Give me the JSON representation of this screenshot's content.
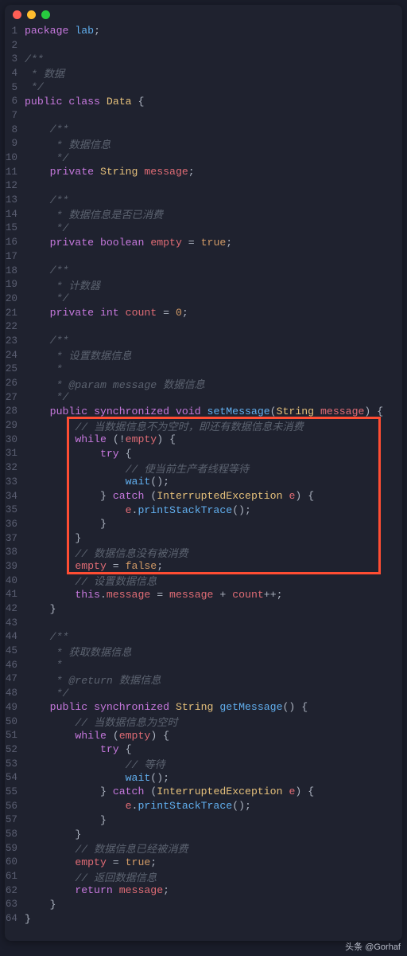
{
  "window": {
    "dots": [
      "red",
      "yellow",
      "green"
    ]
  },
  "code": {
    "lines": [
      [
        [
          "kw",
          "package"
        ],
        [
          "pl",
          " "
        ],
        [
          "id",
          "lab"
        ],
        [
          "pu",
          ";"
        ]
      ],
      [],
      [
        [
          "cm",
          "/**"
        ]
      ],
      [
        [
          "cm",
          " * 数据"
        ]
      ],
      [
        [
          "cm",
          " */"
        ]
      ],
      [
        [
          "kw",
          "public"
        ],
        [
          "pl",
          " "
        ],
        [
          "kw",
          "class"
        ],
        [
          "pl",
          " "
        ],
        [
          "ty",
          "Data"
        ],
        [
          "pl",
          " "
        ],
        [
          "pu",
          "{"
        ]
      ],
      [],
      [
        [
          "pl",
          "    "
        ],
        [
          "cm",
          "/**"
        ]
      ],
      [
        [
          "pl",
          "    "
        ],
        [
          "cm",
          " * 数据信息"
        ]
      ],
      [
        [
          "pl",
          "    "
        ],
        [
          "cm",
          " */"
        ]
      ],
      [
        [
          "pl",
          "    "
        ],
        [
          "kw",
          "private"
        ],
        [
          "pl",
          " "
        ],
        [
          "ty",
          "String"
        ],
        [
          "pl",
          " "
        ],
        [
          "va",
          "message"
        ],
        [
          "pu",
          ";"
        ]
      ],
      [],
      [
        [
          "pl",
          "    "
        ],
        [
          "cm",
          "/**"
        ]
      ],
      [
        [
          "pl",
          "    "
        ],
        [
          "cm",
          " * 数据信息是否已消费"
        ]
      ],
      [
        [
          "pl",
          "    "
        ],
        [
          "cm",
          " */"
        ]
      ],
      [
        [
          "pl",
          "    "
        ],
        [
          "kw",
          "private"
        ],
        [
          "pl",
          " "
        ],
        [
          "kw",
          "boolean"
        ],
        [
          "pl",
          " "
        ],
        [
          "va",
          "empty"
        ],
        [
          "pl",
          " = "
        ],
        [
          "lit",
          "true"
        ],
        [
          "pu",
          ";"
        ]
      ],
      [],
      [
        [
          "pl",
          "    "
        ],
        [
          "cm",
          "/**"
        ]
      ],
      [
        [
          "pl",
          "    "
        ],
        [
          "cm",
          " * 计数器"
        ]
      ],
      [
        [
          "pl",
          "    "
        ],
        [
          "cm",
          " */"
        ]
      ],
      [
        [
          "pl",
          "    "
        ],
        [
          "kw",
          "private"
        ],
        [
          "pl",
          " "
        ],
        [
          "kw",
          "int"
        ],
        [
          "pl",
          " "
        ],
        [
          "va",
          "count"
        ],
        [
          "pl",
          " = "
        ],
        [
          "nm",
          "0"
        ],
        [
          "pu",
          ";"
        ]
      ],
      [],
      [
        [
          "pl",
          "    "
        ],
        [
          "cm",
          "/**"
        ]
      ],
      [
        [
          "pl",
          "    "
        ],
        [
          "cm",
          " * 设置数据信息"
        ]
      ],
      [
        [
          "pl",
          "    "
        ],
        [
          "cm",
          " *"
        ]
      ],
      [
        [
          "pl",
          "    "
        ],
        [
          "cm",
          " * @param message 数据信息"
        ]
      ],
      [
        [
          "pl",
          "    "
        ],
        [
          "cm",
          " */"
        ]
      ],
      [
        [
          "pl",
          "    "
        ],
        [
          "kw",
          "public"
        ],
        [
          "pl",
          " "
        ],
        [
          "kw",
          "synchronized"
        ],
        [
          "pl",
          " "
        ],
        [
          "kw",
          "void"
        ],
        [
          "pl",
          " "
        ],
        [
          "fn",
          "setMessage"
        ],
        [
          "pu",
          "("
        ],
        [
          "ty",
          "String"
        ],
        [
          "pl",
          " "
        ],
        [
          "va",
          "message"
        ],
        [
          "pu",
          ")"
        ],
        [
          "pl",
          " "
        ],
        [
          "pu",
          "{"
        ]
      ],
      [
        [
          "pl",
          "        "
        ],
        [
          "cm",
          "// 当数据信息不为空时，即还有数据信息未消费"
        ]
      ],
      [
        [
          "pl",
          "        "
        ],
        [
          "kw",
          "while"
        ],
        [
          "pl",
          " "
        ],
        [
          "pu",
          "("
        ],
        [
          "pu",
          "!"
        ],
        [
          "va",
          "empty"
        ],
        [
          "pu",
          ")"
        ],
        [
          "pl",
          " "
        ],
        [
          "pu",
          "{"
        ]
      ],
      [
        [
          "pl",
          "            "
        ],
        [
          "kw",
          "try"
        ],
        [
          "pl",
          " "
        ],
        [
          "pu",
          "{"
        ]
      ],
      [
        [
          "pl",
          "                "
        ],
        [
          "cm",
          "// 使当前生产者线程等待"
        ]
      ],
      [
        [
          "pl",
          "                "
        ],
        [
          "fn",
          "wait"
        ],
        [
          "pu",
          "();"
        ]
      ],
      [
        [
          "pl",
          "            "
        ],
        [
          "pu",
          "}"
        ],
        [
          "pl",
          " "
        ],
        [
          "kw",
          "catch"
        ],
        [
          "pl",
          " "
        ],
        [
          "pu",
          "("
        ],
        [
          "ty",
          "InterruptedException"
        ],
        [
          "pl",
          " "
        ],
        [
          "va",
          "e"
        ],
        [
          "pu",
          ")"
        ],
        [
          "pl",
          " "
        ],
        [
          "pu",
          "{"
        ]
      ],
      [
        [
          "pl",
          "                "
        ],
        [
          "va",
          "e"
        ],
        [
          "pu",
          "."
        ],
        [
          "fn",
          "printStackTrace"
        ],
        [
          "pu",
          "();"
        ]
      ],
      [
        [
          "pl",
          "            "
        ],
        [
          "pu",
          "}"
        ]
      ],
      [
        [
          "pl",
          "        "
        ],
        [
          "pu",
          "}"
        ]
      ],
      [
        [
          "pl",
          "        "
        ],
        [
          "cm",
          "// 数据信息没有被消费"
        ]
      ],
      [
        [
          "pl",
          "        "
        ],
        [
          "va",
          "empty"
        ],
        [
          "pl",
          " = "
        ],
        [
          "lit",
          "false"
        ],
        [
          "pu",
          ";"
        ]
      ],
      [
        [
          "pl",
          "        "
        ],
        [
          "cm",
          "// 设置数据信息"
        ]
      ],
      [
        [
          "pl",
          "        "
        ],
        [
          "kw",
          "this"
        ],
        [
          "pu",
          "."
        ],
        [
          "va",
          "message"
        ],
        [
          "pl",
          " = "
        ],
        [
          "va",
          "message"
        ],
        [
          "pl",
          " + "
        ],
        [
          "va",
          "count"
        ],
        [
          "pu",
          "++;"
        ]
      ],
      [
        [
          "pl",
          "    "
        ],
        [
          "pu",
          "}"
        ]
      ],
      [],
      [
        [
          "pl",
          "    "
        ],
        [
          "cm",
          "/**"
        ]
      ],
      [
        [
          "pl",
          "    "
        ],
        [
          "cm",
          " * 获取数据信息"
        ]
      ],
      [
        [
          "pl",
          "    "
        ],
        [
          "cm",
          " *"
        ]
      ],
      [
        [
          "pl",
          "    "
        ],
        [
          "cm",
          " * @return 数据信息"
        ]
      ],
      [
        [
          "pl",
          "    "
        ],
        [
          "cm",
          " */"
        ]
      ],
      [
        [
          "pl",
          "    "
        ],
        [
          "kw",
          "public"
        ],
        [
          "pl",
          " "
        ],
        [
          "kw",
          "synchronized"
        ],
        [
          "pl",
          " "
        ],
        [
          "ty",
          "String"
        ],
        [
          "pl",
          " "
        ],
        [
          "fn",
          "getMessage"
        ],
        [
          "pu",
          "()"
        ],
        [
          "pl",
          " "
        ],
        [
          "pu",
          "{"
        ]
      ],
      [
        [
          "pl",
          "        "
        ],
        [
          "cm",
          "// 当数据信息为空时"
        ]
      ],
      [
        [
          "pl",
          "        "
        ],
        [
          "kw",
          "while"
        ],
        [
          "pl",
          " "
        ],
        [
          "pu",
          "("
        ],
        [
          "va",
          "empty"
        ],
        [
          "pu",
          ")"
        ],
        [
          "pl",
          " "
        ],
        [
          "pu",
          "{"
        ]
      ],
      [
        [
          "pl",
          "            "
        ],
        [
          "kw",
          "try"
        ],
        [
          "pl",
          " "
        ],
        [
          "pu",
          "{"
        ]
      ],
      [
        [
          "pl",
          "                "
        ],
        [
          "cm",
          "// 等待"
        ]
      ],
      [
        [
          "pl",
          "                "
        ],
        [
          "fn",
          "wait"
        ],
        [
          "pu",
          "();"
        ]
      ],
      [
        [
          "pl",
          "            "
        ],
        [
          "pu",
          "}"
        ],
        [
          "pl",
          " "
        ],
        [
          "kw",
          "catch"
        ],
        [
          "pl",
          " "
        ],
        [
          "pu",
          "("
        ],
        [
          "ty",
          "InterruptedException"
        ],
        [
          "pl",
          " "
        ],
        [
          "va",
          "e"
        ],
        [
          "pu",
          ")"
        ],
        [
          "pl",
          " "
        ],
        [
          "pu",
          "{"
        ]
      ],
      [
        [
          "pl",
          "                "
        ],
        [
          "va",
          "e"
        ],
        [
          "pu",
          "."
        ],
        [
          "fn",
          "printStackTrace"
        ],
        [
          "pu",
          "();"
        ]
      ],
      [
        [
          "pl",
          "            "
        ],
        [
          "pu",
          "}"
        ]
      ],
      [
        [
          "pl",
          "        "
        ],
        [
          "pu",
          "}"
        ]
      ],
      [
        [
          "pl",
          "        "
        ],
        [
          "cm",
          "// 数据信息已经被消费"
        ]
      ],
      [
        [
          "pl",
          "        "
        ],
        [
          "va",
          "empty"
        ],
        [
          "pl",
          " = "
        ],
        [
          "lit",
          "true"
        ],
        [
          "pu",
          ";"
        ]
      ],
      [
        [
          "pl",
          "        "
        ],
        [
          "cm",
          "// 返回数据信息"
        ]
      ],
      [
        [
          "pl",
          "        "
        ],
        [
          "kw",
          "return"
        ],
        [
          "pl",
          " "
        ],
        [
          "va",
          "message"
        ],
        [
          "pu",
          ";"
        ]
      ],
      [
        [
          "pl",
          "    "
        ],
        [
          "pu",
          "}"
        ]
      ],
      [
        [
          "pu",
          "}"
        ]
      ]
    ]
  },
  "highlight": {
    "startLine": 29,
    "endLine": 39
  },
  "footer": {
    "text": "头条 @Gorhaf"
  }
}
